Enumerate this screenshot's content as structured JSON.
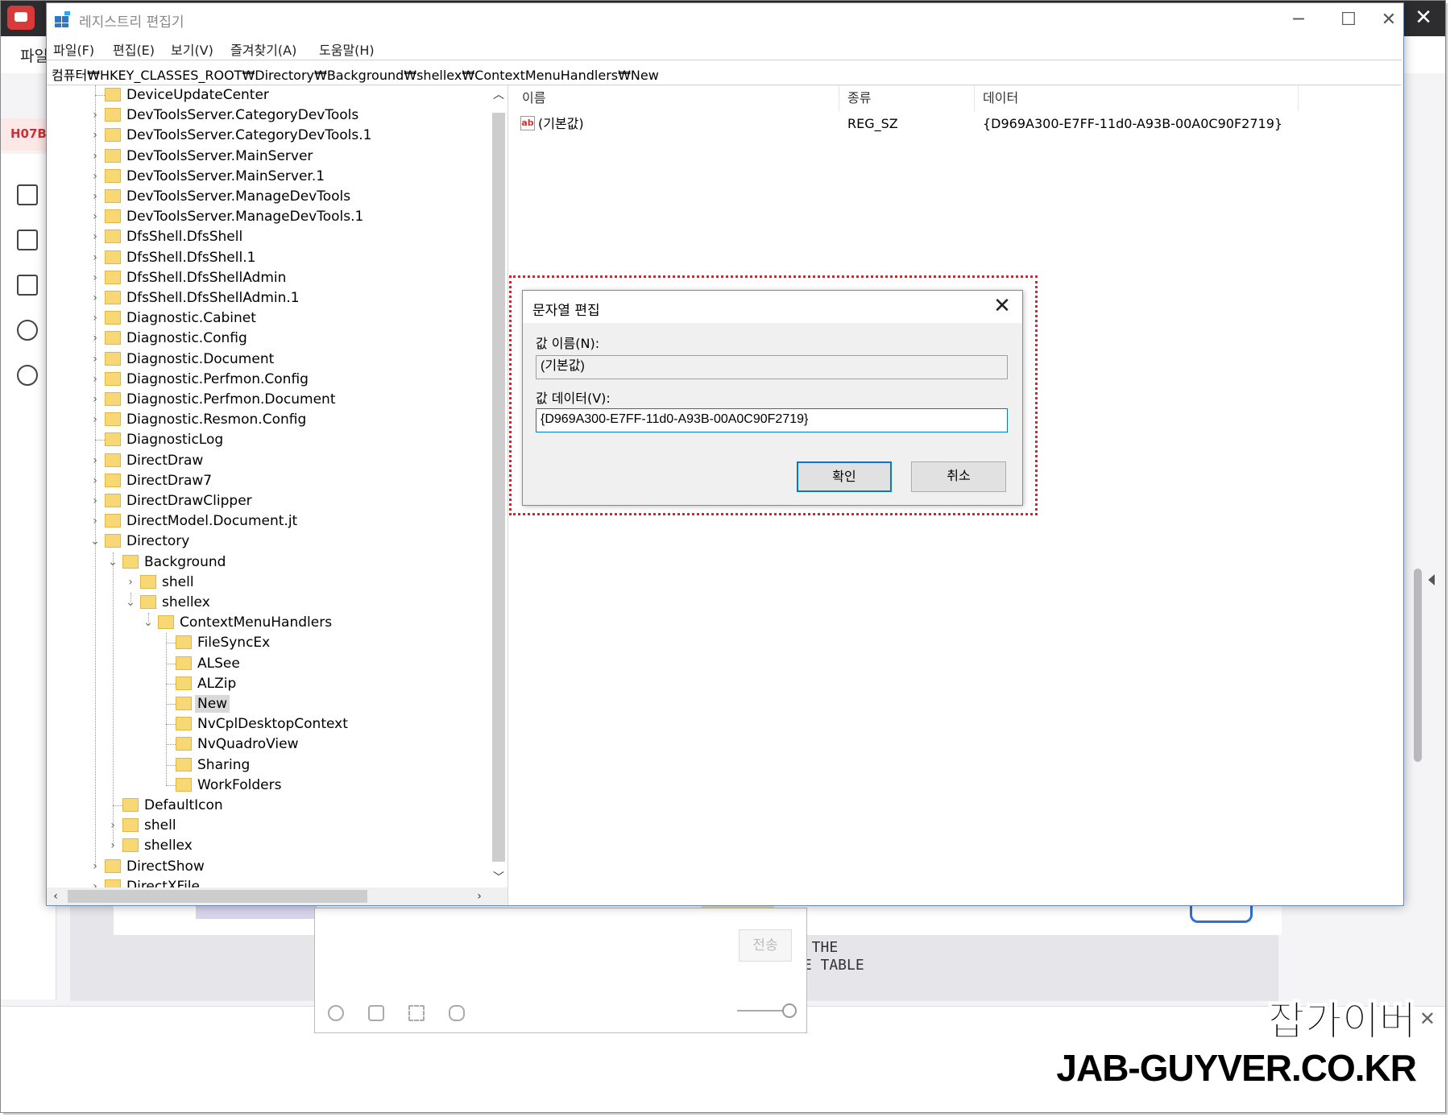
{
  "background_app": {
    "menu_file": "파일",
    "tab_code": "H07B",
    "send_label": "전송",
    "note_line1": ") THE",
    "note_line2": "HE TABLE",
    "watermark_korean": "잡가이버",
    "watermark_domain": "JAB-GUYVER.CO.KR"
  },
  "window": {
    "title": "레지스트리 편집기",
    "controls": {
      "minimize": "─",
      "maximize": "☐",
      "close": "✕"
    }
  },
  "menu": [
    "파일(F)",
    "편집(E)",
    "보기(V)",
    "즐겨찾기(A)",
    "도움말(H)"
  ],
  "address": "컴퓨터₩HKEY_CLASSES_ROOT₩Directory₩Background₩shellex₩ContextMenuHandlers₩New",
  "tree": [
    {
      "label": "DeviceUpdateCenter",
      "level": 0,
      "arrow": ""
    },
    {
      "label": "DevToolsServer.CategoryDevTools",
      "level": 0,
      "arrow": ">"
    },
    {
      "label": "DevToolsServer.CategoryDevTools.1",
      "level": 0,
      "arrow": ">"
    },
    {
      "label": "DevToolsServer.MainServer",
      "level": 0,
      "arrow": ">"
    },
    {
      "label": "DevToolsServer.MainServer.1",
      "level": 0,
      "arrow": ">"
    },
    {
      "label": "DevToolsServer.ManageDevTools",
      "level": 0,
      "arrow": ">"
    },
    {
      "label": "DevToolsServer.ManageDevTools.1",
      "level": 0,
      "arrow": ">"
    },
    {
      "label": "DfsShell.DfsShell",
      "level": 0,
      "arrow": ">"
    },
    {
      "label": "DfsShell.DfsShell.1",
      "level": 0,
      "arrow": ">"
    },
    {
      "label": "DfsShell.DfsShellAdmin",
      "level": 0,
      "arrow": ">"
    },
    {
      "label": "DfsShell.DfsShellAdmin.1",
      "level": 0,
      "arrow": ">"
    },
    {
      "label": "Diagnostic.Cabinet",
      "level": 0,
      "arrow": ">"
    },
    {
      "label": "Diagnostic.Config",
      "level": 0,
      "arrow": ">"
    },
    {
      "label": "Diagnostic.Document",
      "level": 0,
      "arrow": ">"
    },
    {
      "label": "Diagnostic.Perfmon.Config",
      "level": 0,
      "arrow": ">"
    },
    {
      "label": "Diagnostic.Perfmon.Document",
      "level": 0,
      "arrow": ">"
    },
    {
      "label": "Diagnostic.Resmon.Config",
      "level": 0,
      "arrow": ">"
    },
    {
      "label": "DiagnosticLog",
      "level": 0,
      "arrow": ""
    },
    {
      "label": "DirectDraw",
      "level": 0,
      "arrow": ">"
    },
    {
      "label": "DirectDraw7",
      "level": 0,
      "arrow": ">"
    },
    {
      "label": "DirectDrawClipper",
      "level": 0,
      "arrow": ">"
    },
    {
      "label": "DirectModel.Document.jt",
      "level": 0,
      "arrow": ">"
    },
    {
      "label": "Directory",
      "level": 0,
      "arrow": "v"
    },
    {
      "label": "Background",
      "level": 1,
      "arrow": "v"
    },
    {
      "label": "shell",
      "level": 2,
      "arrow": ">"
    },
    {
      "label": "shellex",
      "level": 2,
      "arrow": "v"
    },
    {
      "label": "ContextMenuHandlers",
      "level": 3,
      "arrow": "v"
    },
    {
      "label": "FileSyncEx",
      "level": 4,
      "arrow": ""
    },
    {
      "label": "ALSee",
      "level": 4,
      "arrow": ""
    },
    {
      "label": "ALZip",
      "level": 4,
      "arrow": ""
    },
    {
      "label": "New",
      "level": 4,
      "arrow": "",
      "selected": true
    },
    {
      "label": "NvCplDesktopContext",
      "level": 4,
      "arrow": ""
    },
    {
      "label": "NvQuadroView",
      "level": 4,
      "arrow": ""
    },
    {
      "label": "Sharing",
      "level": 4,
      "arrow": ""
    },
    {
      "label": "WorkFolders",
      "level": 4,
      "arrow": ""
    },
    {
      "label": "DefaultIcon",
      "level": 1,
      "arrow": ""
    },
    {
      "label": "shell",
      "level": 1,
      "arrow": ">"
    },
    {
      "label": "shellex",
      "level": 1,
      "arrow": ">"
    },
    {
      "label": "DirectShow",
      "level": 0,
      "arrow": ">"
    },
    {
      "label": "DirectXFile",
      "level": 0,
      "arrow": ">"
    }
  ],
  "list": {
    "columns": [
      "이름",
      "종류",
      "데이터"
    ],
    "rows": [
      {
        "name": "(기본값)",
        "type": "REG_SZ",
        "data": "{D969A300-E7FF-11d0-A93B-00A0C90F2719}"
      }
    ]
  },
  "dialog": {
    "title": "문자열 편집",
    "close": "✕",
    "name_label": "값 이름(N):",
    "name_value": "(기본값)",
    "data_label": "값 데이터(V):",
    "data_value": "{D969A300-E7FF-11d0-A93B-00A0C90F2719}",
    "ok_label": "확인",
    "cancel_label": "취소"
  },
  "colors": {
    "highlight_border": "#e0202a",
    "folder": "#f8d775",
    "focus": "#0078d7"
  }
}
